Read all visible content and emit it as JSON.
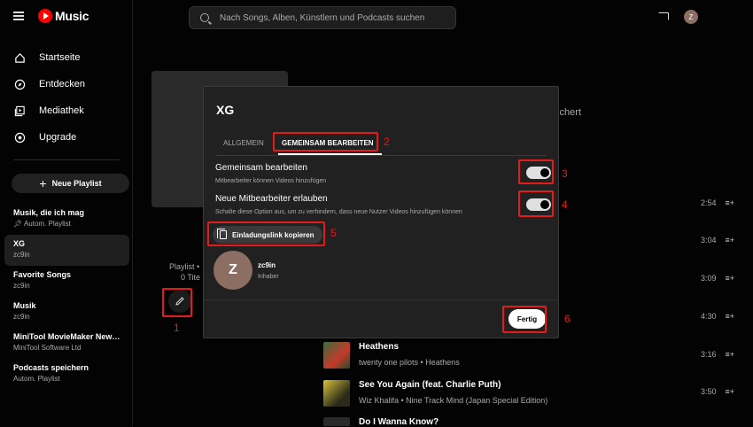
{
  "app": {
    "logo_text": "Music",
    "avatar_letter": "Z"
  },
  "search": {
    "placeholder": "Nach Songs, Alben, Künstlern und Podcasts suchen"
  },
  "nav": [
    {
      "label": "Startseite",
      "icon": "home-icon"
    },
    {
      "label": "Entdecken",
      "icon": "compass-icon"
    },
    {
      "label": "Mediathek",
      "icon": "library-icon"
    },
    {
      "label": "Upgrade",
      "icon": "upgrade-icon"
    }
  ],
  "new_playlist_label": "Neue Playlist",
  "playlists": [
    {
      "title": "Musik, die ich mag",
      "sub": "Autom. Playlist",
      "pinned": true
    },
    {
      "title": "XG",
      "sub": "zc9in",
      "active": true
    },
    {
      "title": "Favorite Songs",
      "sub": "zc9in"
    },
    {
      "title": "Musik",
      "sub": "zc9in"
    },
    {
      "title": "MiniTool MovieMaker New F...",
      "sub": "MiniTool Software Ltd"
    },
    {
      "title": "Podcasts speichern",
      "sub": "Autom. Playlist"
    }
  ],
  "background": {
    "saved_text": "eichert",
    "playlist_label": "Playlist •",
    "titles_count": "0 Tite",
    "durations": [
      "2:54",
      "3:04",
      "3:09",
      "4:30",
      "3:16",
      "3:50"
    ],
    "tracks": [
      {
        "title": "Heathens",
        "sub": "twenty one pilots • Heathens"
      },
      {
        "title": "See You Again (feat. Charlie Puth)",
        "sub": "Wiz Khalifa • Nine Track Mind (Japan Special Edition)"
      },
      {
        "title": "Do I Wanna Know?",
        "sub": ""
      }
    ]
  },
  "dialog": {
    "title": "XG",
    "tabs": [
      "ALLGEMEIN",
      "GEMEINSAM BEARBEITEN"
    ],
    "collab_title": "Gemeinsam bearbeiten",
    "collab_sub": "Mitbearbeiter können Videos hinzufügen",
    "allow_title": "Neue Mitbearbeiter erlauben",
    "allow_sub": "Schalte diese Option aus, um zu verhindern, dass neue Nutzer Videos hinzufügen können",
    "invite_label": "Einladungslink kopieren",
    "member": {
      "initial": "Z",
      "name": "zc9in",
      "role": "Inhaber"
    },
    "done_label": "Fertig"
  },
  "annotations": [
    "1",
    "2",
    "3",
    "4",
    "5",
    "6"
  ],
  "colors": {
    "annotation": "#e31b1b",
    "brand": "#ff0000"
  }
}
